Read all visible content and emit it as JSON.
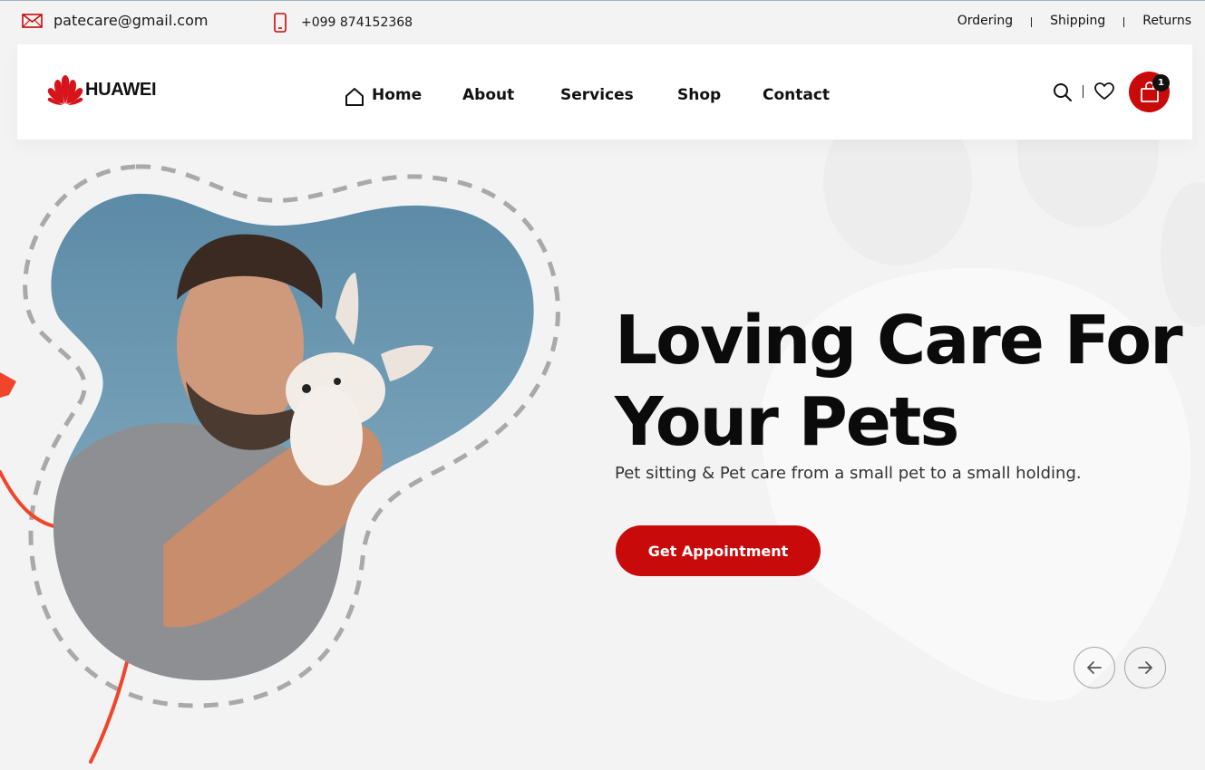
{
  "topbar": {
    "email": "patecare@gmail.com",
    "phone": "+099 874152368",
    "links": [
      "Ordering",
      "Shipping",
      "Returns"
    ]
  },
  "header": {
    "logo_text": "HUAWEI",
    "nav": [
      "Home",
      "About",
      "Services",
      "Shop",
      "Contact"
    ],
    "cart_count": "1"
  },
  "hero": {
    "title_line1": "Loving Care For",
    "title_line2": "Your Pets",
    "subtitle": "Pet sitting & Pet care from a small pet to a small holding.",
    "cta_label": "Get Appointment"
  },
  "colors": {
    "accent": "#c80a0a",
    "background": "#f3f3f3",
    "dashed_outline": "#a9a9a9",
    "orange_line": "#f0452a"
  },
  "icons": [
    "mail-icon",
    "phone-icon",
    "home-icon",
    "search-icon",
    "heart-icon",
    "shopping-bag-icon",
    "arrow-left-icon",
    "arrow-right-icon"
  ]
}
